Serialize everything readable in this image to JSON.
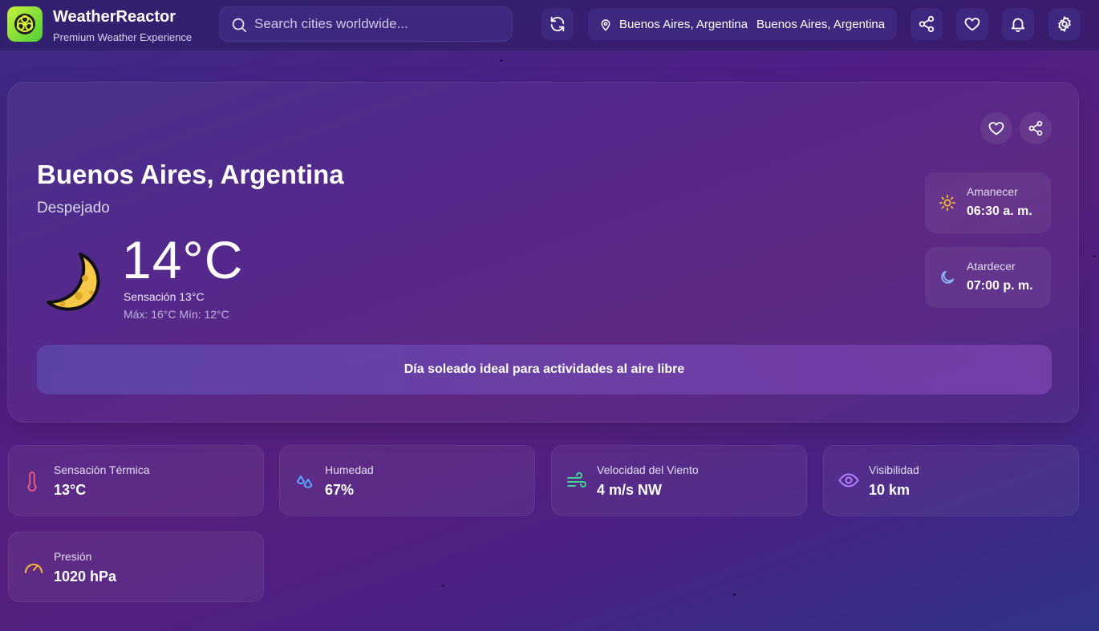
{
  "app": {
    "title": "WeatherReactor",
    "subtitle": "Premium Weather Experience"
  },
  "search": {
    "placeholder": "Search cities worldwide...",
    "value": ""
  },
  "location_chip": {
    "primary": "Buenos Aires, Argentina",
    "secondary": "Buenos Aires, Argentina"
  },
  "header_icons": [
    "refresh-icon",
    "map-pin-icon",
    "share-icon",
    "heart-icon",
    "bell-icon",
    "gear-icon"
  ],
  "current": {
    "city": "Buenos Aires, Argentina",
    "condition": "Despejado",
    "temperature": "14°C",
    "feels_like": "Sensación 13°C",
    "min_max": "Máx: 16°C Mín: 12°C",
    "weather_icon": "crescent-moon-icon",
    "sunrise_label": "Amanecer",
    "sunrise_value": "06:30 a. m.",
    "sunset_label": "Atardecer",
    "sunset_value": "07:00 p. m.",
    "banner": "Día soleado ideal para actividades al aire libre"
  },
  "stats": [
    {
      "label": "Sensación Térmica",
      "value": "13°C",
      "icon": "thermometer-icon",
      "color": "#f0607a"
    },
    {
      "label": "Humedad",
      "value": "67%",
      "icon": "droplets-icon",
      "color": "#5aa8ff"
    },
    {
      "label": "Velocidad del Viento",
      "value": "4 m/s NW",
      "icon": "wind-icon",
      "color": "#3fd48f"
    },
    {
      "label": "Visibilidad",
      "value": "10 km",
      "icon": "eye-icon",
      "color": "#b07cff"
    },
    {
      "label": "Presión",
      "value": "1020 hPa",
      "icon": "gauge-icon",
      "color": "#f5b82e"
    }
  ],
  "colors": {
    "sun_icon": "#f5b82e",
    "moon_icon": "#8fb8ff",
    "logo_bg": "#b8e83a"
  }
}
